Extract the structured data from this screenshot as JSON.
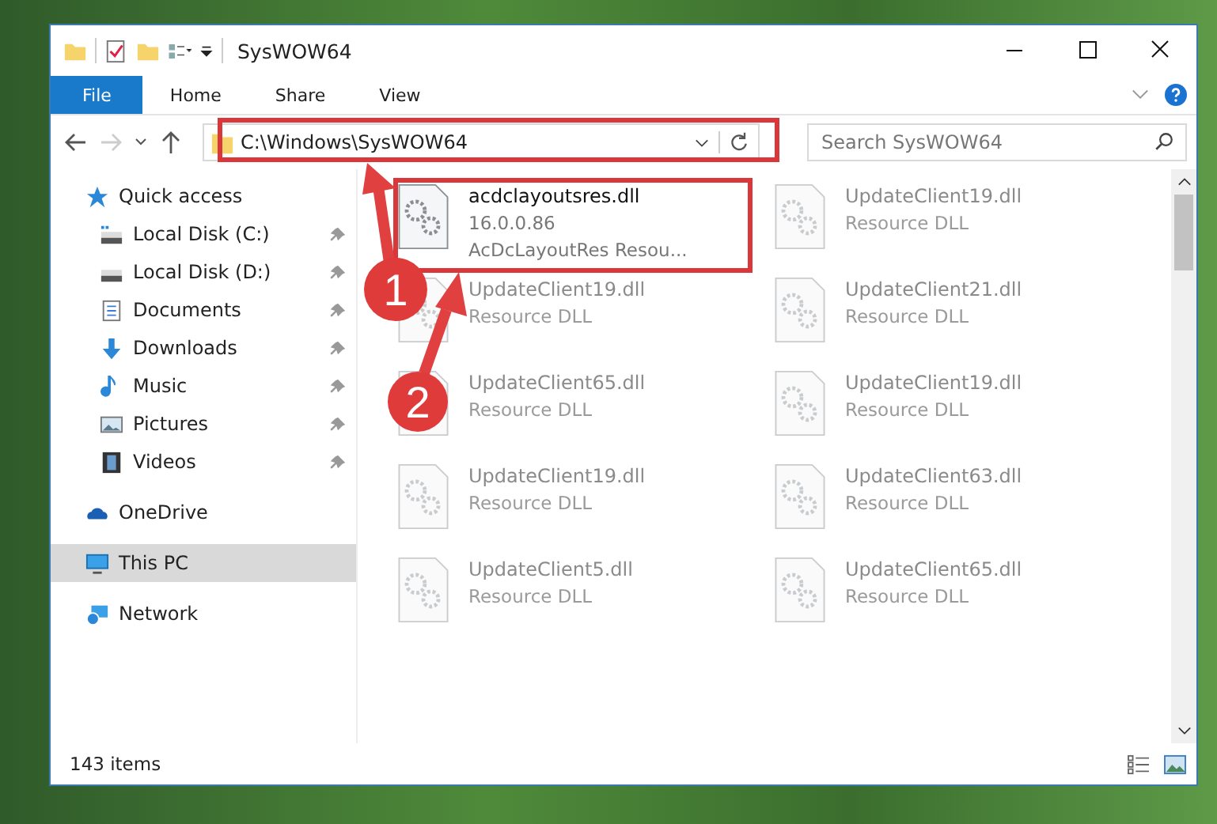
{
  "window": {
    "title": "SysWOW64"
  },
  "ribbon_tabs": [
    {
      "label": "File",
      "selected": true
    },
    {
      "label": "Home",
      "selected": false
    },
    {
      "label": "Share",
      "selected": false
    },
    {
      "label": "View",
      "selected": false
    }
  ],
  "address_bar": {
    "value": "C:\\Windows\\SysWOW64"
  },
  "search": {
    "placeholder": "Search SysWOW64"
  },
  "sidebar": {
    "items": [
      {
        "label": "Quick access",
        "kind": "quick",
        "pinned": false,
        "selected": false,
        "children": [
          {
            "label": "Local Disk (C:)",
            "kind": "disk-c",
            "pinned": true,
            "selected": false
          },
          {
            "label": "Local Disk (D:)",
            "kind": "disk",
            "pinned": true,
            "selected": false
          },
          {
            "label": "Documents",
            "kind": "documents",
            "pinned": true,
            "selected": false
          },
          {
            "label": "Downloads",
            "kind": "downloads",
            "pinned": true,
            "selected": false
          },
          {
            "label": "Music",
            "kind": "music",
            "pinned": true,
            "selected": false
          },
          {
            "label": "Pictures",
            "kind": "pictures",
            "pinned": true,
            "selected": false
          },
          {
            "label": "Videos",
            "kind": "videos",
            "pinned": true,
            "selected": false
          }
        ]
      },
      {
        "label": "OneDrive",
        "kind": "cloud",
        "pinned": false,
        "selected": false
      },
      {
        "label": "This PC",
        "kind": "pc",
        "pinned": false,
        "selected": true
      },
      {
        "label": "Network",
        "kind": "network",
        "pinned": false,
        "selected": false
      }
    ]
  },
  "files": [
    {
      "name": "acdclayoutsres.dll",
      "version": "16.0.0.86",
      "description": "AcDcLayoutRes Resou...",
      "blurred": false
    },
    {
      "name": "UpdateClient19.dll",
      "description": "Resource DLL",
      "blurred": true
    },
    {
      "name": "UpdateClient19.dll",
      "description": "Resource DLL",
      "blurred": true
    },
    {
      "name": "UpdateClient21.dll",
      "description": "Resource DLL",
      "blurred": true
    },
    {
      "name": "UpdateClient65.dll",
      "description": "Resource DLL",
      "blurred": true
    },
    {
      "name": "UpdateClient19.dll",
      "description": "Resource DLL",
      "blurred": true
    },
    {
      "name": "UpdateClient19.dll",
      "description": "Resource DLL",
      "blurred": true
    },
    {
      "name": "UpdateClient63.dll",
      "description": "Resource DLL",
      "blurred": true
    },
    {
      "name": "UpdateClient5.dll",
      "description": "Resource DLL",
      "blurred": true
    },
    {
      "name": "UpdateClient65.dll",
      "description": "Resource DLL",
      "blurred": true
    }
  ],
  "status_bar": {
    "item_count": "143 items"
  },
  "annotations": [
    {
      "label": "1"
    },
    {
      "label": "2"
    }
  ]
}
